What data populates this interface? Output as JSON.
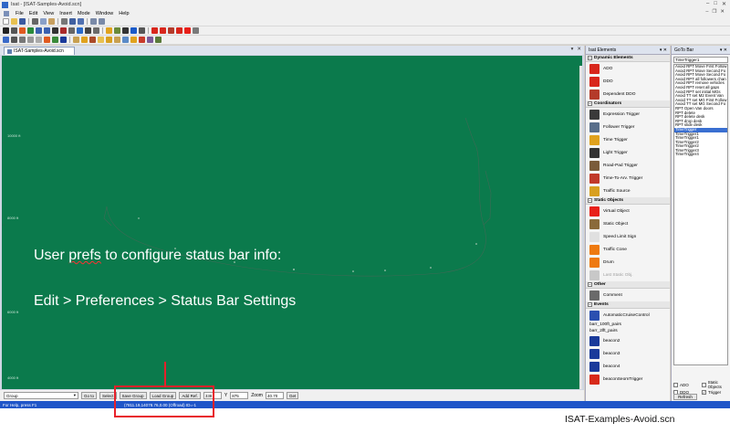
{
  "window": {
    "title": "Isat - [ISAT-Samples-Avoid.scn]"
  },
  "menu": [
    "File",
    "Edit",
    "View",
    "Insert",
    "Mode",
    "Window",
    "Help"
  ],
  "document": {
    "tab_label": "ISAT-Samples-Avoid.scn",
    "axis_labels": [
      "10000 ft",
      "8000 ft",
      "6000 ft",
      "4000 ft"
    ]
  },
  "overlay": {
    "line1_pre": "User ",
    "line1_word": "prefs",
    "line1_post": " to configure status bar info:",
    "line2": "Edit > Preferences > Status Bar Settings"
  },
  "bottom_bar": {
    "group_label": "Group",
    "goto_btn": "Go to",
    "select_btn": "Select",
    "save_group_btn": "Save Group",
    "load_group_btn": "Load Group",
    "add_ref_btn": "Add Ref.",
    "x_value": "338",
    "y_label": "Y",
    "y_value": "875",
    "zoom_label": "Zoom",
    "zoom_value": "40.70",
    "get_btn": "Get"
  },
  "status": {
    "help_text": "For Help, press F1",
    "info_text": "(7811.19,14078.76,0.00 (Offroad) ID=-1"
  },
  "elements_panel": {
    "title": "Isat Elements",
    "categories": [
      {
        "name": "Dynamic Elements",
        "items": [
          {
            "label": "ADO",
            "color": "#d8261c"
          },
          {
            "label": "DDO",
            "color": "#d8261c"
          },
          {
            "label": "Dependent DDO",
            "color": "#b43a2a"
          }
        ]
      },
      {
        "name": "Coordinators",
        "items": [
          {
            "label": "Expression Trigger",
            "color": "#3a3a3a"
          },
          {
            "label": "Follower Trigger",
            "color": "#5a6f8a"
          },
          {
            "label": "Time Trigger",
            "color": "#e0a21e"
          },
          {
            "label": "Light Trigger",
            "color": "#333333"
          },
          {
            "label": "Road-Pad Trigger",
            "color": "#7a5b3a"
          },
          {
            "label": "Time-To-Arv. Trigger",
            "color": "#c13a2a"
          },
          {
            "label": "Traffic Source",
            "color": "#d8a020"
          }
        ]
      },
      {
        "name": "Static Objects",
        "items": [
          {
            "label": "Virtual Object",
            "color": "#e8201a"
          },
          {
            "label": "Static Object",
            "color": "#8a6a3a"
          },
          {
            "label": "Speed Limit Sign",
            "color": "#e0e0e0"
          },
          {
            "label": "Traffic Cone",
            "color": "#ee7a10"
          },
          {
            "label": "Drum",
            "color": "#ee7a10"
          },
          {
            "label": "Last Static Obj.",
            "color": "#c8c8c8",
            "disabled": true
          }
        ]
      },
      {
        "name": "Other",
        "items": [
          {
            "label": "Comment",
            "color": "#6a6a6a"
          }
        ]
      },
      {
        "name": "Events",
        "items": [
          {
            "label": "AutomaticCruiseControl",
            "color": "#2b4fb0"
          },
          {
            "label": "barr_100ft_pairs",
            "plain": true
          },
          {
            "label": "barr_2lft_pairs",
            "plain": true
          },
          {
            "label": "beacon2",
            "color": "#1a3a9a"
          },
          {
            "label": "beacon3",
            "color": "#1a3a9a"
          },
          {
            "label": "beacon4",
            "color": "#1a3a9a"
          },
          {
            "label": "beaconSeomTrigger",
            "color": "#d82a1a"
          }
        ]
      }
    ]
  },
  "goto_panel": {
    "title": "GoTo Bar",
    "input_value": "TimeTrigger1",
    "items": [
      "Avoid RPT Move First Follow",
      "Avoid RPT Move Second Fo",
      "Avoid RPT Move Second Fo",
      "Avoid RPT all followers chan",
      "Avoid RPT remove vehicles",
      "Avoid RPT reset all gaps",
      "Avoid RPT set initial MGs",
      "Avoid TT set M2 Event Van",
      "Avoid TT set MG First Follow",
      "Avoid TT set MG Second Fo",
      "RPT Open Van doors",
      "RPT delete",
      "RPT delete desk",
      "RPT drop desk",
      "RPT slide desk",
      "TimeTrigger",
      "TimeTrigger1",
      "TimeTrigger1",
      "TimeTrigger2",
      "TimeTrigger2",
      "TimeTrigger3",
      "TimeTrigger4"
    ],
    "selected_index": 15,
    "checks": [
      {
        "label": "ADO",
        "checked": false
      },
      {
        "label": "Static Objects",
        "checked": false
      },
      {
        "label": "DDO",
        "checked": false
      },
      {
        "label": "Trigger",
        "checked": true
      }
    ],
    "refresh_btn": "Refresh"
  },
  "caption": "ISAT-Examples-Avoid.scn",
  "colors": {
    "canvas": "#0b7a4c",
    "status_bar": "#1f55c8",
    "annotation": "#e8202a"
  }
}
